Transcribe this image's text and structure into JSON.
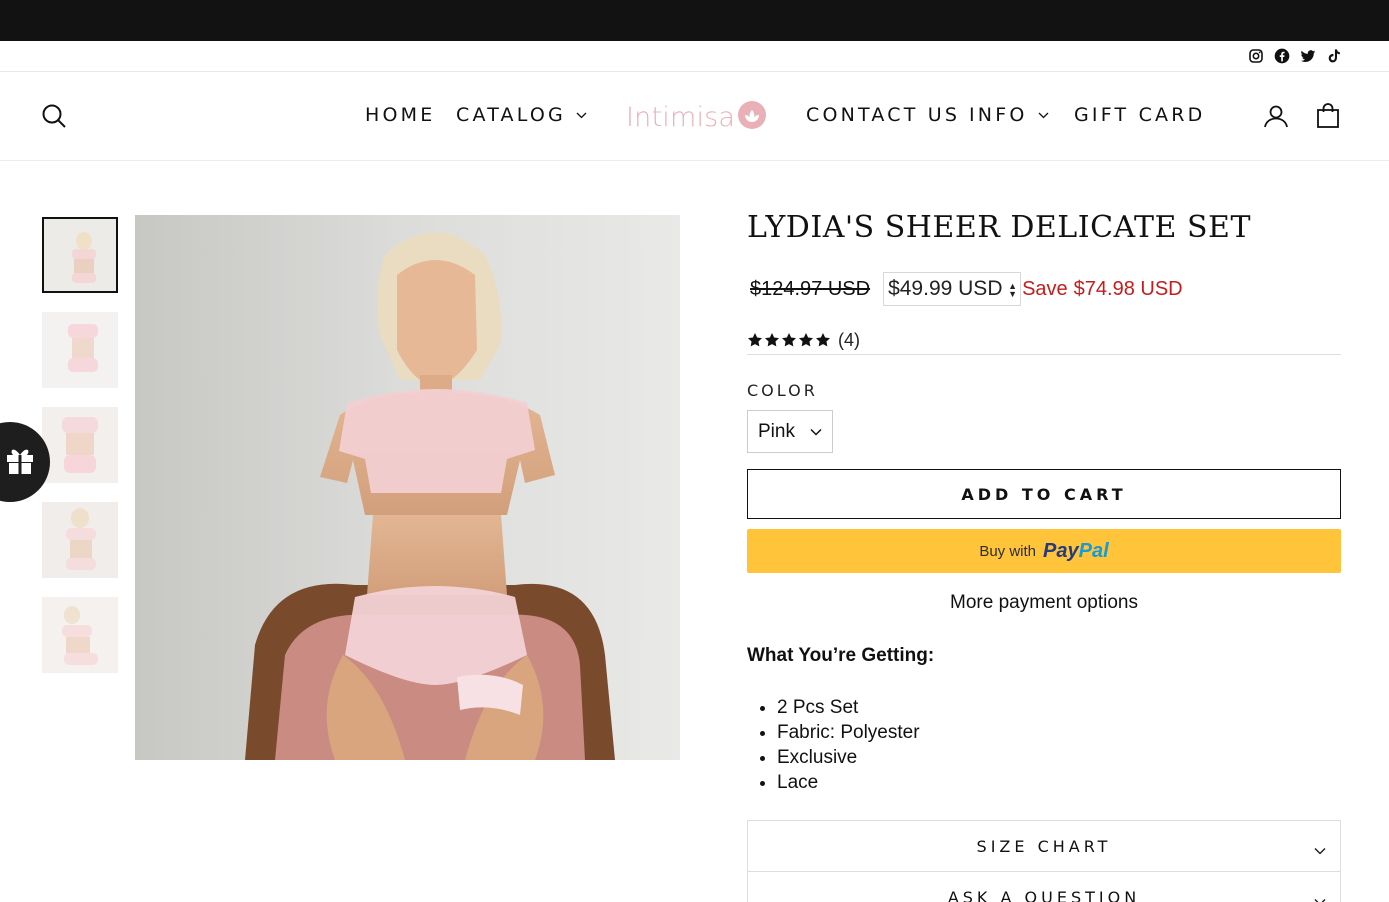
{
  "header": {
    "social": [
      "instagram-icon",
      "facebook-icon",
      "twitter-icon",
      "tiktok-icon"
    ],
    "nav": {
      "home": "HOME",
      "catalog": "CATALOG",
      "contact": "CONTACT US",
      "info": "INFO",
      "gift_card": "GIFT CARD"
    },
    "logo_text": "Intimisa"
  },
  "product": {
    "title": "LYDIA'S SHEER DELICATE SET",
    "old_price": "$124.97 USD",
    "price": "$49.99 USD",
    "save_label": "Save",
    "save_amount": "$74.98 USD",
    "rating_stars": 5,
    "review_count": "(4)",
    "color_label": "COLOR",
    "color_value": "Pink",
    "add_to_cart": "ADD TO CART",
    "paypal_prefix": "Buy with",
    "paypal_pay": "Pay",
    "paypal_pal": "Pal",
    "more_payment": "More payment options",
    "getting_title": "What You’re Getting:",
    "features": [
      "2 Pcs Set",
      "Fabric: Polyester",
      "Exclusive",
      "Lace"
    ],
    "accordions": [
      "SIZE CHART",
      "ASK A QUESTION"
    ]
  },
  "colors": {
    "announce_bar": "#121212",
    "save_red": "#c41d1d",
    "paypal_yellow": "#ffc439",
    "logo_pink": "#e9b0ba"
  }
}
